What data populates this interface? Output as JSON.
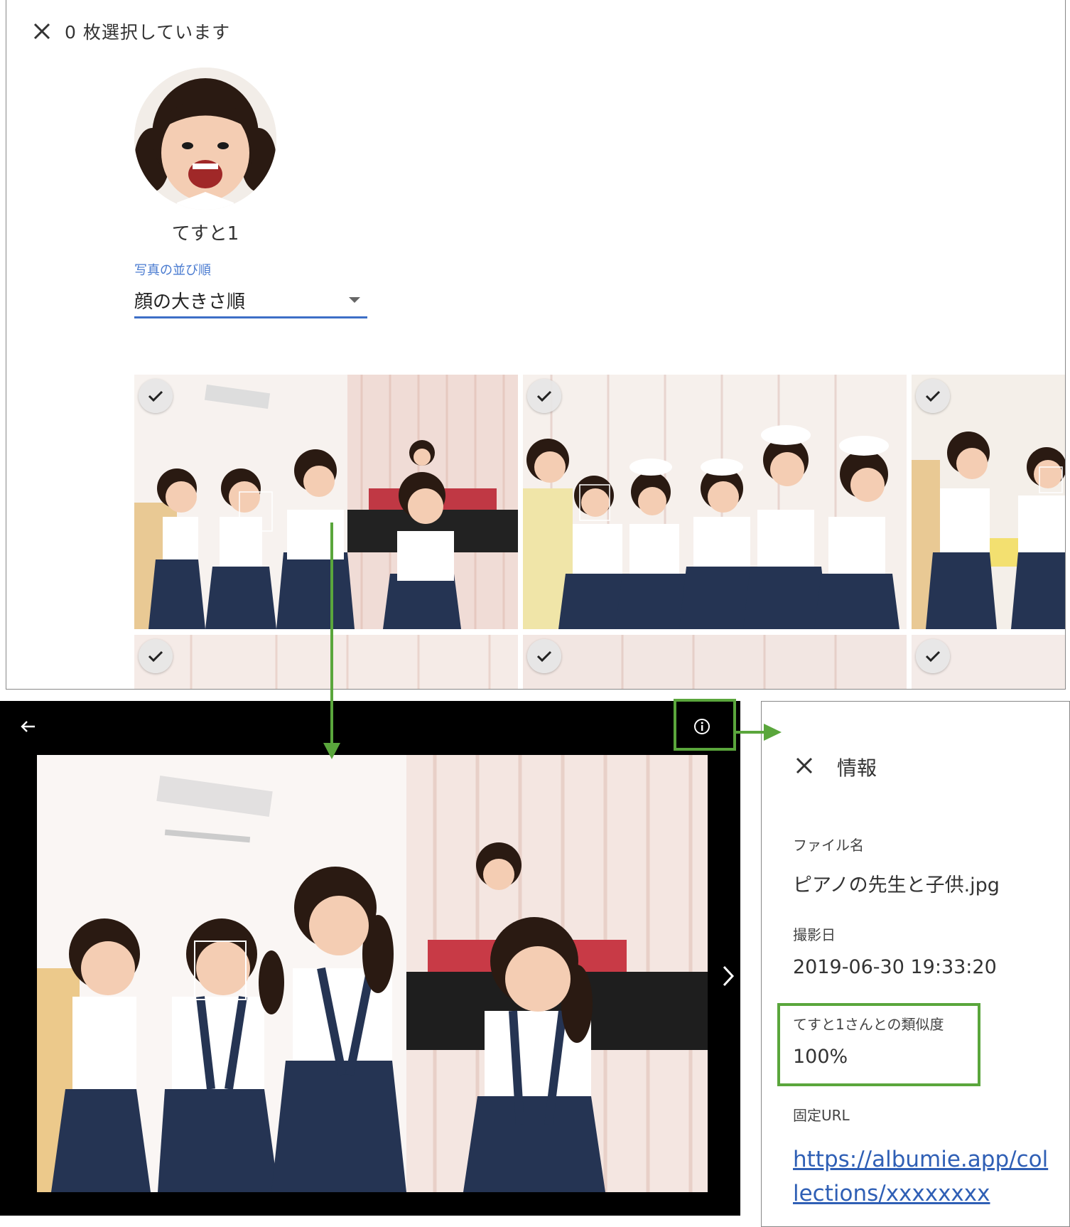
{
  "top": {
    "selection_count": "0 枚選択しています",
    "person_name": "てすと1",
    "sort": {
      "label": "写真の並び順",
      "value": "顔の大きさ順"
    }
  },
  "info": {
    "title": "情報",
    "file_name_label": "ファイル名",
    "file_name": "ピアノの先生と子供.jpg",
    "date_label": "撮影日",
    "date": "2019-06-30 19:33:20",
    "similarity_label": "てすと1さんとの類似度",
    "similarity": "100%",
    "url_label": "固定URL",
    "url": "https://albumie.app/collections/xxxxxxxx"
  },
  "colors": {
    "highlight": "#5aa63c",
    "link": "#2f5fb5",
    "accent": "#3d6fc6"
  }
}
